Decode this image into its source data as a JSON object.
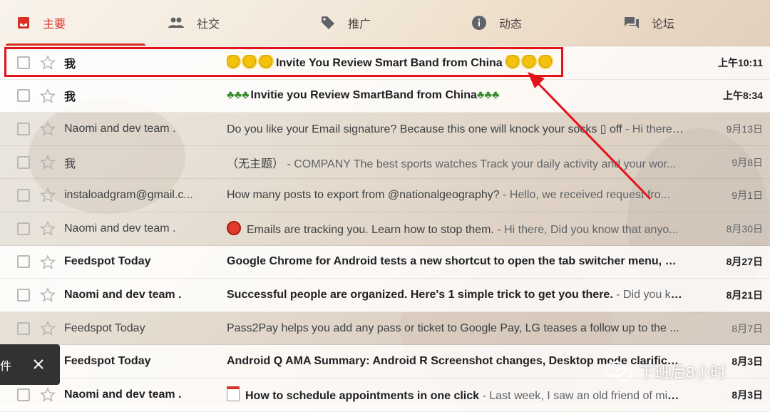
{
  "tabs": [
    {
      "label": "主要",
      "icon": "inbox-icon",
      "active": true
    },
    {
      "label": "社交",
      "icon": "people-icon",
      "active": false
    },
    {
      "label": "推广",
      "icon": "tag-icon",
      "active": false
    },
    {
      "label": "动态",
      "icon": "info-icon",
      "active": false
    },
    {
      "label": "论坛",
      "icon": "forum-icon",
      "active": false
    }
  ],
  "emails": [
    {
      "sender": "我",
      "subject": "Invite You Review Smart Band from China",
      "snippet": "",
      "date": "上午10:11",
      "unread": true,
      "emoji": "sun"
    },
    {
      "sender": "我",
      "subject": "Invitie you Review SmartBand from China",
      "snippet": "",
      "date": "上午8:34",
      "unread": true,
      "emoji": "palm"
    },
    {
      "sender": "Naomi and dev team .",
      "subject": "Do you like your Email signature? Because this one will knock your socks ▯ off",
      "snippet": " - Hi there, ...",
      "date": "9月13日",
      "unread": false
    },
    {
      "sender": "我",
      "subject": "（无主题）",
      "snippet": " - COMPANY The best sports watches Track your daily activity and your wor...",
      "date": "9月8日",
      "unread": false
    },
    {
      "sender": "instaloadgram@gmail.c...",
      "subject": "How many posts to export from @nationalgeography?",
      "snippet": " - Hello, we received request fro...",
      "date": "9月1日",
      "unread": false
    },
    {
      "sender": "Naomi and dev team .",
      "subject": "Emails are tracking you. Learn how to stop them.",
      "snippet": " - Hi there, Did you know that anyo...",
      "date": "8月30日",
      "unread": false,
      "emoji": "stop"
    },
    {
      "sender": "Feedspot Today",
      "subject": "Google Chrome for Android tests a new shortcut to open the tab switcher menu, Moto...",
      "snippet": "",
      "date": "8月27日",
      "unread": true
    },
    {
      "sender": "Naomi and dev team .",
      "subject": "Successful people are organized. Here's 1 simple trick to get you there.",
      "snippet": " - Did you kno...",
      "date": "8月21日",
      "unread": true
    },
    {
      "sender": "Feedspot Today",
      "subject": "Pass2Pay helps you add any pass or ticket to Google Pay, LG teases a follow up to the ...",
      "snippet": "",
      "date": "8月7日",
      "unread": false
    },
    {
      "sender": "Feedspot Today",
      "subject": "Android Q AMA Summary: Android R Screenshot changes, Desktop mode clarification...",
      "snippet": "",
      "date": "8月3日",
      "unread": true
    },
    {
      "sender": "Naomi and dev team .",
      "subject": "How to schedule appointments in one click",
      "snippet": " - Last week, I saw an old friend of mine ...",
      "date": "8月3日",
      "unread": true,
      "emoji": "calendar"
    }
  ],
  "snackbar": {
    "text": "件",
    "close_icon": "close-icon"
  },
  "watermark": {
    "text": "下班后8小时",
    "icon": "wechat-icon"
  },
  "colors": {
    "accent": "#d93025",
    "highlight": "#e4121b"
  }
}
